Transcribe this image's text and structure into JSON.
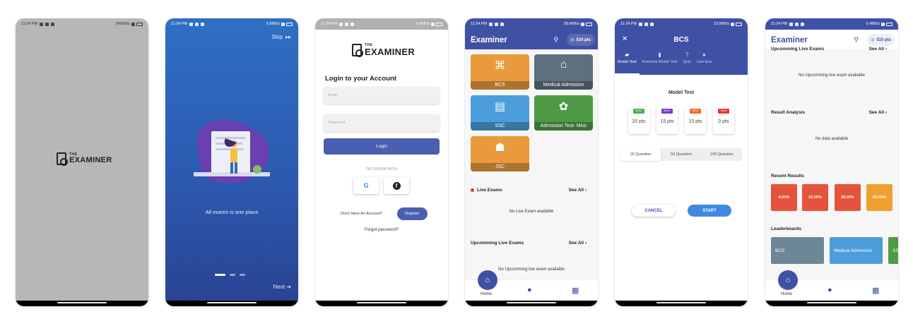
{
  "status": {
    "time": "11:24 PM",
    "speeds": [
      "345KB/s",
      "6.6KB/s",
      "0.0KB/s",
      "28.6KB/s",
      "19.5KB/s",
      "0.4KB/s"
    ]
  },
  "splash": {
    "the": "THE",
    "examiner": "EXAMINER"
  },
  "onboarding": {
    "skip": "Skip",
    "tagline": "All exams is one place",
    "next": "Next"
  },
  "login": {
    "the": "THE",
    "examiner": "EXAMINER",
    "title": "Login to your Account",
    "email_placeholder": "Email",
    "password_placeholder": "Password",
    "login_button": "Login",
    "or_signin": "OR SIGNIN WITH",
    "google": "G",
    "facebook": "f",
    "no_account": "Don't Have An Account?",
    "register": "Register",
    "forgot": "Forgot password?"
  },
  "home": {
    "app_title": "Examiner",
    "points": "510 pts",
    "tiles": [
      {
        "label": "BCS",
        "color": "#e99a3c",
        "icon": "⌘"
      },
      {
        "label": "Medical Admission",
        "color": "#5e6f7d",
        "icon": "⌂"
      },
      {
        "label": "SSC",
        "color": "#4b9edb",
        "icon": "▤"
      },
      {
        "label": "Admission Test- Misc",
        "color": "#4f9a45",
        "icon": "✿"
      },
      {
        "label": "JSC",
        "color": "#e99a3c",
        "icon": "☗"
      }
    ],
    "live_exams": "Live Exams",
    "see_all": "See All",
    "no_live": "No Live Exam available",
    "upcoming": "Upcomming Live Exams",
    "no_upcoming": "No Upcomming live exam available",
    "nav_home": "Home"
  },
  "bcs": {
    "title": "BCS",
    "tabs": [
      "Model Test",
      "Premium Model Test",
      "Quiz",
      "Live Exa"
    ],
    "model_test": "Model Test",
    "point_badges": [
      {
        "badge": "80%+",
        "color": "#4caf50",
        "value": "20 pts"
      },
      {
        "badge": "60%+",
        "color": "#7b3fc4",
        "value": "15 pts"
      },
      {
        "badge": "50%+",
        "color": "#f06a2a",
        "value": "10 pts"
      },
      {
        "badge": "<50%",
        "color": "#e53935",
        "value": "0 pts"
      }
    ],
    "question_options": [
      "20 Question",
      "50 Question",
      "100 Question"
    ],
    "cancel": "CANCEL",
    "start": "START"
  },
  "dashboard": {
    "app_title": "Examiner",
    "points": "510 pts",
    "upcoming": "Upcomming Live Exams",
    "see_all": "See All",
    "no_upcoming": "No Upcomming live exam available",
    "result_analysis": "Result Analysis",
    "no_data": "No data available",
    "recent_results": "Recent Results",
    "results": [
      {
        "value": "0.00%",
        "color": "#e5533d"
      },
      {
        "value": "20.00%",
        "color": "#e5533d"
      },
      {
        "value": "30.00%",
        "color": "#e5533d"
      },
      {
        "value": "50.00%",
        "color": "#f0a030"
      }
    ],
    "leaderboards": "Leaderboards",
    "boards": [
      {
        "label": "BCS",
        "color": "#6e8796"
      },
      {
        "label": "Medical Admission",
        "color": "#4b9edb"
      },
      {
        "label": "SSC",
        "color": "#4f9a45"
      }
    ],
    "nav_home": "Home"
  }
}
